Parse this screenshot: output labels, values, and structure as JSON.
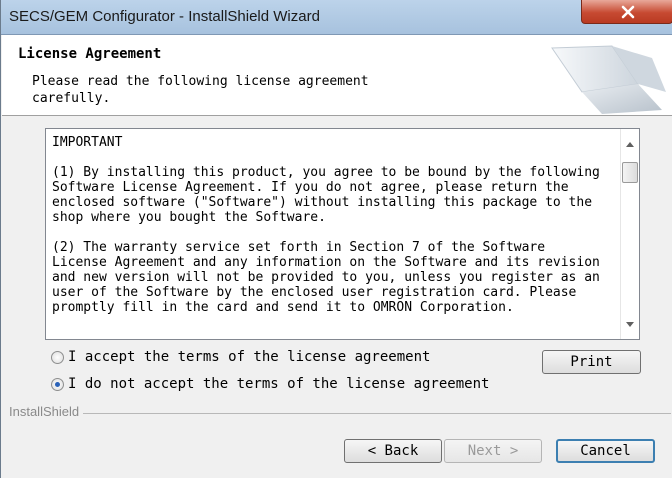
{
  "window": {
    "title": "SECS/GEM Configurator - InstallShield Wizard",
    "close_glyph": "x"
  },
  "header": {
    "title": "License Agreement",
    "subtitle": "Please read the following license agreement carefully."
  },
  "license": {
    "text": "IMPORTANT\n\n(1) By installing this product, you agree to be bound by the following\nSoftware License Agreement. If you do not agree, please return the\nenclosed software (\"Software\") without installing this package to the\nshop where you bought the Software.\n\n(2) The warranty service set forth in Section 7 of the Software\nLicense Agreement and any information on the Software and its revision\nand new version will not be provided to you, unless you register as an\nuser of the Software by the enclosed user registration card. Please\npromptly fill in the card and send it to OMRON Corporation."
  },
  "options": {
    "accept_label": "I accept the terms of the license agreement",
    "decline_label": "I do not accept the terms of the license agreement",
    "selected": "decline"
  },
  "buttons": {
    "print": "Print",
    "back": "< Back",
    "next": "Next >",
    "cancel": "Cancel"
  },
  "footer": {
    "brand": "InstallShield"
  },
  "icons": {
    "close": "close-icon",
    "scroll_up": "scroll-up-arrow-icon",
    "scroll_down": "scroll-down-arrow-icon",
    "logo": "installshield-banner-graphic"
  }
}
